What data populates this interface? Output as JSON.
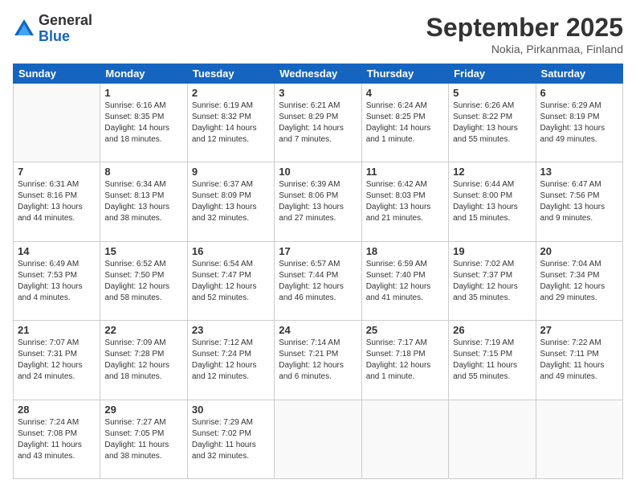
{
  "header": {
    "logo_general": "General",
    "logo_blue": "Blue",
    "month_title": "September 2025",
    "location": "Nokia, Pirkanmaa, Finland"
  },
  "days_of_week": [
    "Sunday",
    "Monday",
    "Tuesday",
    "Wednesday",
    "Thursday",
    "Friday",
    "Saturday"
  ],
  "weeks": [
    [
      {
        "day": "",
        "info": ""
      },
      {
        "day": "1",
        "info": "Sunrise: 6:16 AM\nSunset: 8:35 PM\nDaylight: 14 hours\nand 18 minutes."
      },
      {
        "day": "2",
        "info": "Sunrise: 6:19 AM\nSunset: 8:32 PM\nDaylight: 14 hours\nand 12 minutes."
      },
      {
        "day": "3",
        "info": "Sunrise: 6:21 AM\nSunset: 8:29 PM\nDaylight: 14 hours\nand 7 minutes."
      },
      {
        "day": "4",
        "info": "Sunrise: 6:24 AM\nSunset: 8:25 PM\nDaylight: 14 hours\nand 1 minute."
      },
      {
        "day": "5",
        "info": "Sunrise: 6:26 AM\nSunset: 8:22 PM\nDaylight: 13 hours\nand 55 minutes."
      },
      {
        "day": "6",
        "info": "Sunrise: 6:29 AM\nSunset: 8:19 PM\nDaylight: 13 hours\nand 49 minutes."
      }
    ],
    [
      {
        "day": "7",
        "info": "Sunrise: 6:31 AM\nSunset: 8:16 PM\nDaylight: 13 hours\nand 44 minutes."
      },
      {
        "day": "8",
        "info": "Sunrise: 6:34 AM\nSunset: 8:13 PM\nDaylight: 13 hours\nand 38 minutes."
      },
      {
        "day": "9",
        "info": "Sunrise: 6:37 AM\nSunset: 8:09 PM\nDaylight: 13 hours\nand 32 minutes."
      },
      {
        "day": "10",
        "info": "Sunrise: 6:39 AM\nSunset: 8:06 PM\nDaylight: 13 hours\nand 27 minutes."
      },
      {
        "day": "11",
        "info": "Sunrise: 6:42 AM\nSunset: 8:03 PM\nDaylight: 13 hours\nand 21 minutes."
      },
      {
        "day": "12",
        "info": "Sunrise: 6:44 AM\nSunset: 8:00 PM\nDaylight: 13 hours\nand 15 minutes."
      },
      {
        "day": "13",
        "info": "Sunrise: 6:47 AM\nSunset: 7:56 PM\nDaylight: 13 hours\nand 9 minutes."
      }
    ],
    [
      {
        "day": "14",
        "info": "Sunrise: 6:49 AM\nSunset: 7:53 PM\nDaylight: 13 hours\nand 4 minutes."
      },
      {
        "day": "15",
        "info": "Sunrise: 6:52 AM\nSunset: 7:50 PM\nDaylight: 12 hours\nand 58 minutes."
      },
      {
        "day": "16",
        "info": "Sunrise: 6:54 AM\nSunset: 7:47 PM\nDaylight: 12 hours\nand 52 minutes."
      },
      {
        "day": "17",
        "info": "Sunrise: 6:57 AM\nSunset: 7:44 PM\nDaylight: 12 hours\nand 46 minutes."
      },
      {
        "day": "18",
        "info": "Sunrise: 6:59 AM\nSunset: 7:40 PM\nDaylight: 12 hours\nand 41 minutes."
      },
      {
        "day": "19",
        "info": "Sunrise: 7:02 AM\nSunset: 7:37 PM\nDaylight: 12 hours\nand 35 minutes."
      },
      {
        "day": "20",
        "info": "Sunrise: 7:04 AM\nSunset: 7:34 PM\nDaylight: 12 hours\nand 29 minutes."
      }
    ],
    [
      {
        "day": "21",
        "info": "Sunrise: 7:07 AM\nSunset: 7:31 PM\nDaylight: 12 hours\nand 24 minutes."
      },
      {
        "day": "22",
        "info": "Sunrise: 7:09 AM\nSunset: 7:28 PM\nDaylight: 12 hours\nand 18 minutes."
      },
      {
        "day": "23",
        "info": "Sunrise: 7:12 AM\nSunset: 7:24 PM\nDaylight: 12 hours\nand 12 minutes."
      },
      {
        "day": "24",
        "info": "Sunrise: 7:14 AM\nSunset: 7:21 PM\nDaylight: 12 hours\nand 6 minutes."
      },
      {
        "day": "25",
        "info": "Sunrise: 7:17 AM\nSunset: 7:18 PM\nDaylight: 12 hours\nand 1 minute."
      },
      {
        "day": "26",
        "info": "Sunrise: 7:19 AM\nSunset: 7:15 PM\nDaylight: 11 hours\nand 55 minutes."
      },
      {
        "day": "27",
        "info": "Sunrise: 7:22 AM\nSunset: 7:11 PM\nDaylight: 11 hours\nand 49 minutes."
      }
    ],
    [
      {
        "day": "28",
        "info": "Sunrise: 7:24 AM\nSunset: 7:08 PM\nDaylight: 11 hours\nand 43 minutes."
      },
      {
        "day": "29",
        "info": "Sunrise: 7:27 AM\nSunset: 7:05 PM\nDaylight: 11 hours\nand 38 minutes."
      },
      {
        "day": "30",
        "info": "Sunrise: 7:29 AM\nSunset: 7:02 PM\nDaylight: 11 hours\nand 32 minutes."
      },
      {
        "day": "",
        "info": ""
      },
      {
        "day": "",
        "info": ""
      },
      {
        "day": "",
        "info": ""
      },
      {
        "day": "",
        "info": ""
      }
    ]
  ]
}
